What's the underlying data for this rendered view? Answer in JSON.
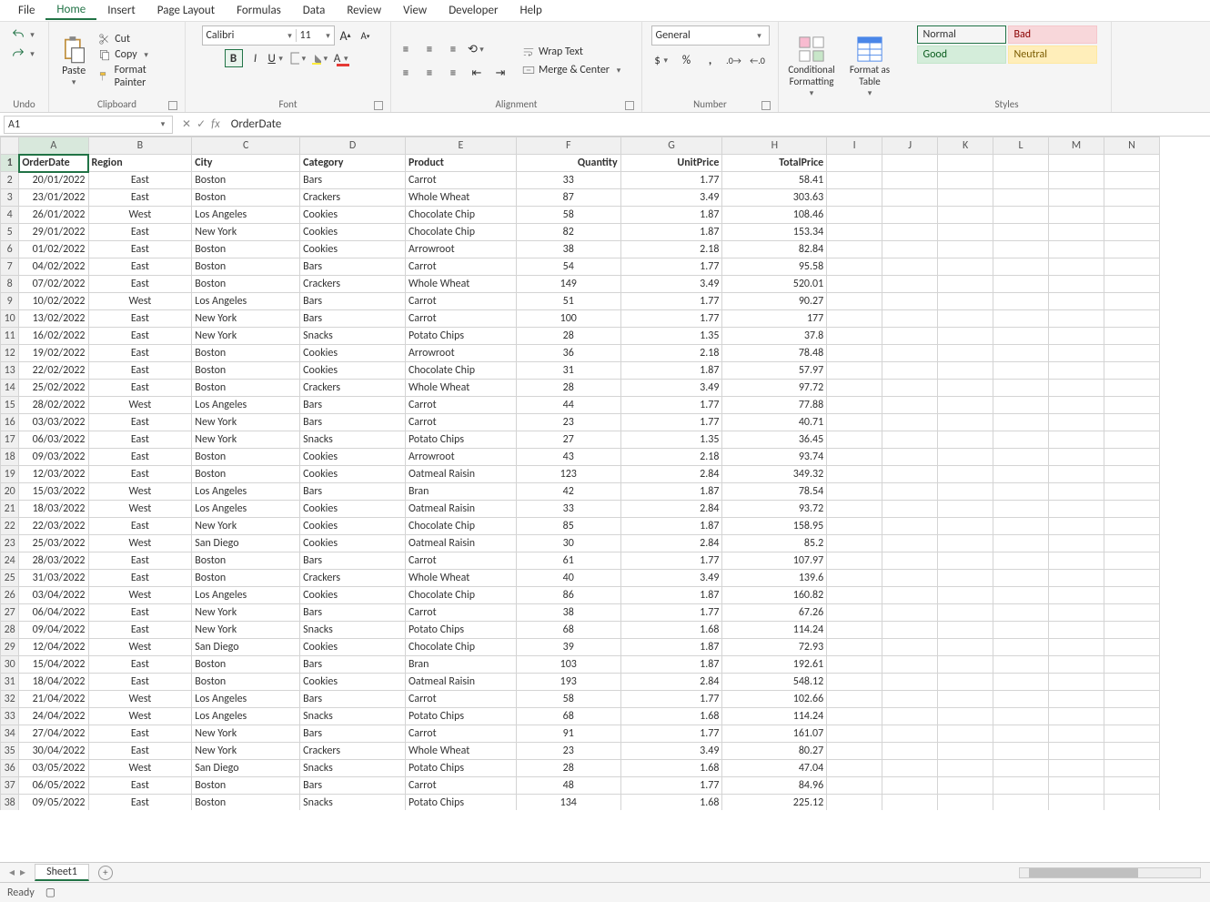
{
  "menubar": [
    "File",
    "Home",
    "Insert",
    "Page Layout",
    "Formulas",
    "Data",
    "Review",
    "View",
    "Developer",
    "Help"
  ],
  "active_menu": "Home",
  "ribbon": {
    "undo_label": "Undo",
    "clipboard": {
      "paste": "Paste",
      "cut": "Cut",
      "copy": "Copy",
      "painter": "Format Painter",
      "label": "Clipboard"
    },
    "font": {
      "name": "Calibri",
      "size": "11",
      "label": "Font"
    },
    "alignment": {
      "wrap": "Wrap Text",
      "merge": "Merge & Center",
      "label": "Alignment"
    },
    "number": {
      "format": "General",
      "label": "Number"
    },
    "cond_fmt": "Conditional Formatting",
    "fmt_table": "Format as Table",
    "styles": {
      "normal": "Normal",
      "bad": "Bad",
      "good": "Good",
      "neutral": "Neutral",
      "label": "Styles"
    }
  },
  "namebox": "A1",
  "formula": "OrderDate",
  "columns": [
    "A",
    "B",
    "C",
    "D",
    "E",
    "F",
    "G",
    "H",
    "I",
    "J",
    "K",
    "L",
    "M",
    "N"
  ],
  "headers": [
    "OrderDate",
    "Region",
    "City",
    "Category",
    "Product",
    "Quantity",
    "UnitPrice",
    "TotalPrice"
  ],
  "rows": [
    [
      "20/01/2022",
      "East",
      "Boston",
      "Bars",
      "Carrot",
      "33",
      "1.77",
      "58.41"
    ],
    [
      "23/01/2022",
      "East",
      "Boston",
      "Crackers",
      "Whole Wheat",
      "87",
      "3.49",
      "303.63"
    ],
    [
      "26/01/2022",
      "West",
      "Los Angeles",
      "Cookies",
      "Chocolate Chip",
      "58",
      "1.87",
      "108.46"
    ],
    [
      "29/01/2022",
      "East",
      "New York",
      "Cookies",
      "Chocolate Chip",
      "82",
      "1.87",
      "153.34"
    ],
    [
      "01/02/2022",
      "East",
      "Boston",
      "Cookies",
      "Arrowroot",
      "38",
      "2.18",
      "82.84"
    ],
    [
      "04/02/2022",
      "East",
      "Boston",
      "Bars",
      "Carrot",
      "54",
      "1.77",
      "95.58"
    ],
    [
      "07/02/2022",
      "East",
      "Boston",
      "Crackers",
      "Whole Wheat",
      "149",
      "3.49",
      "520.01"
    ],
    [
      "10/02/2022",
      "West",
      "Los Angeles",
      "Bars",
      "Carrot",
      "51",
      "1.77",
      "90.27"
    ],
    [
      "13/02/2022",
      "East",
      "New York",
      "Bars",
      "Carrot",
      "100",
      "1.77",
      "177"
    ],
    [
      "16/02/2022",
      "East",
      "New York",
      "Snacks",
      "Potato Chips",
      "28",
      "1.35",
      "37.8"
    ],
    [
      "19/02/2022",
      "East",
      "Boston",
      "Cookies",
      "Arrowroot",
      "36",
      "2.18",
      "78.48"
    ],
    [
      "22/02/2022",
      "East",
      "Boston",
      "Cookies",
      "Chocolate Chip",
      "31",
      "1.87",
      "57.97"
    ],
    [
      "25/02/2022",
      "East",
      "Boston",
      "Crackers",
      "Whole Wheat",
      "28",
      "3.49",
      "97.72"
    ],
    [
      "28/02/2022",
      "West",
      "Los Angeles",
      "Bars",
      "Carrot",
      "44",
      "1.77",
      "77.88"
    ],
    [
      "03/03/2022",
      "East",
      "New York",
      "Bars",
      "Carrot",
      "23",
      "1.77",
      "40.71"
    ],
    [
      "06/03/2022",
      "East",
      "New York",
      "Snacks",
      "Potato Chips",
      "27",
      "1.35",
      "36.45"
    ],
    [
      "09/03/2022",
      "East",
      "Boston",
      "Cookies",
      "Arrowroot",
      "43",
      "2.18",
      "93.74"
    ],
    [
      "12/03/2022",
      "East",
      "Boston",
      "Cookies",
      "Oatmeal Raisin",
      "123",
      "2.84",
      "349.32"
    ],
    [
      "15/03/2022",
      "West",
      "Los Angeles",
      "Bars",
      "Bran",
      "42",
      "1.87",
      "78.54"
    ],
    [
      "18/03/2022",
      "West",
      "Los Angeles",
      "Cookies",
      "Oatmeal Raisin",
      "33",
      "2.84",
      "93.72"
    ],
    [
      "22/03/2022",
      "East",
      "New York",
      "Cookies",
      "Chocolate Chip",
      "85",
      "1.87",
      "158.95"
    ],
    [
      "25/03/2022",
      "West",
      "San Diego",
      "Cookies",
      "Oatmeal Raisin",
      "30",
      "2.84",
      "85.2"
    ],
    [
      "28/03/2022",
      "East",
      "Boston",
      "Bars",
      "Carrot",
      "61",
      "1.77",
      "107.97"
    ],
    [
      "31/03/2022",
      "East",
      "Boston",
      "Crackers",
      "Whole Wheat",
      "40",
      "3.49",
      "139.6"
    ],
    [
      "03/04/2022",
      "West",
      "Los Angeles",
      "Cookies",
      "Chocolate Chip",
      "86",
      "1.87",
      "160.82"
    ],
    [
      "06/04/2022",
      "East",
      "New York",
      "Bars",
      "Carrot",
      "38",
      "1.77",
      "67.26"
    ],
    [
      "09/04/2022",
      "East",
      "New York",
      "Snacks",
      "Potato Chips",
      "68",
      "1.68",
      "114.24"
    ],
    [
      "12/04/2022",
      "West",
      "San Diego",
      "Cookies",
      "Chocolate Chip",
      "39",
      "1.87",
      "72.93"
    ],
    [
      "15/04/2022",
      "East",
      "Boston",
      "Bars",
      "Bran",
      "103",
      "1.87",
      "192.61"
    ],
    [
      "18/04/2022",
      "East",
      "Boston",
      "Cookies",
      "Oatmeal Raisin",
      "193",
      "2.84",
      "548.12"
    ],
    [
      "21/04/2022",
      "West",
      "Los Angeles",
      "Bars",
      "Carrot",
      "58",
      "1.77",
      "102.66"
    ],
    [
      "24/04/2022",
      "West",
      "Los Angeles",
      "Snacks",
      "Potato Chips",
      "68",
      "1.68",
      "114.24"
    ],
    [
      "27/04/2022",
      "East",
      "New York",
      "Bars",
      "Carrot",
      "91",
      "1.77",
      "161.07"
    ],
    [
      "30/04/2022",
      "East",
      "New York",
      "Crackers",
      "Whole Wheat",
      "23",
      "3.49",
      "80.27"
    ],
    [
      "03/05/2022",
      "West",
      "San Diego",
      "Snacks",
      "Potato Chips",
      "28",
      "1.68",
      "47.04"
    ],
    [
      "06/05/2022",
      "East",
      "Boston",
      "Bars",
      "Carrot",
      "48",
      "1.77",
      "84.96"
    ],
    [
      "09/05/2022",
      "East",
      "Boston",
      "Snacks",
      "Potato Chips",
      "134",
      "1.68",
      "225.12"
    ]
  ],
  "sheet_tab": "Sheet1",
  "status": "Ready"
}
